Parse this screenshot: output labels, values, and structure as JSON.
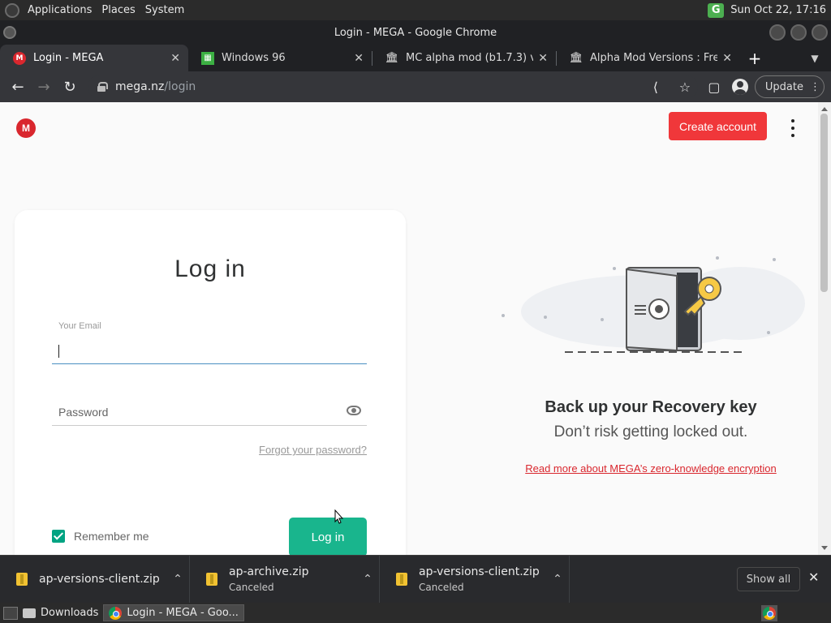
{
  "top_panel": {
    "menus": [
      "Applications",
      "Places",
      "System"
    ],
    "tray_letter": "G",
    "clock": "Sun Oct 22, 17:16"
  },
  "window": {
    "title": "Login - MEGA - Google Chrome"
  },
  "tabs": [
    {
      "label": "Login - MEGA",
      "favicon": "mega-icon",
      "active": true
    },
    {
      "label": "Windows 96",
      "favicon": "windows96-icon",
      "active": false
    },
    {
      "label": "MC alpha mod (b1.7.3) versi",
      "favicon": "archive-icon",
      "active": false
    },
    {
      "label": "Alpha Mod Versions : Free D",
      "favicon": "archive-icon",
      "active": false
    }
  ],
  "toolbar": {
    "url_host": "mega.nz",
    "url_path": "/login",
    "update_label": "Update"
  },
  "page": {
    "logo_letter": "M",
    "create_account": "Create account",
    "login_title": "Log in",
    "email_label": "Your Email",
    "email_value": "",
    "password_placeholder": "Password",
    "forgot_password": "Forgot your password?",
    "remember_me": "Remember me",
    "login_button": "Log in",
    "recovery_title": "Back up your Recovery key",
    "recovery_subtitle": "Don’t risk getting locked out.",
    "recovery_link": "Read more about MEGA’s zero-knowledge encryption"
  },
  "downloads": [
    {
      "name": "ap-versions-client.zip",
      "status": ""
    },
    {
      "name": "ap-archive.zip",
      "status": "Canceled"
    },
    {
      "name": "ap-versions-client.zip",
      "status": "Canceled"
    }
  ],
  "download_shelf": {
    "show_all": "Show all"
  },
  "taskbar": {
    "items": [
      "Downloads",
      "Login - MEGA - Goo..."
    ]
  },
  "colors": {
    "mega_red": "#d9272e",
    "create_btn": "#f0373a",
    "login_green": "#19b58d",
    "checkbox_green": "#00a382"
  }
}
